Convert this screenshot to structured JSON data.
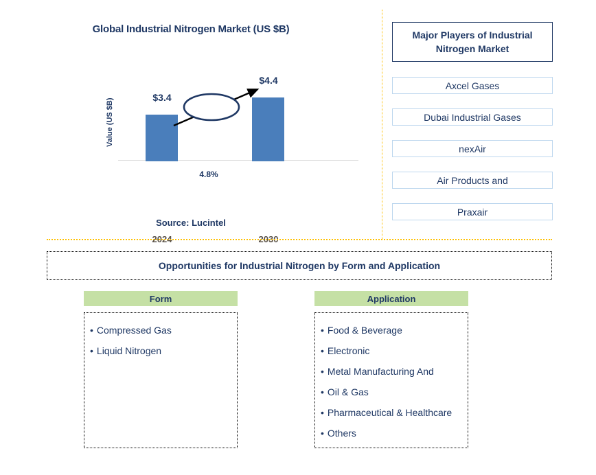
{
  "chart": {
    "title": "Global Industrial Nitrogen Market (US $B)",
    "y_axis_label": "Value (US $B)",
    "cagr_label": "4.8%",
    "source": "Source: Lucintel",
    "bar_color": "#4a7ebb",
    "label_color": "#1f3864"
  },
  "chart_data": {
    "type": "bar",
    "title": "Global Industrial Nitrogen Market (US $B)",
    "categories": [
      "2024",
      "2030"
    ],
    "values": [
      3.4,
      4.4
    ],
    "value_labels": [
      "$3.4",
      "$4.4"
    ],
    "xlabel": "",
    "ylabel": "Value (US $B)",
    "ylim": [
      0,
      5.2
    ],
    "grid": false,
    "legend": "none",
    "annotation": "4.8%",
    "annotation_meaning": "CAGR from 2024 to 2030",
    "source": "Source: Lucintel",
    "units": "US $B"
  },
  "players": {
    "header": "Major Players of Industrial Nitrogen Market",
    "items": [
      "Axcel Gases",
      "Dubai Industrial Gases",
      "nexAir",
      "Air Products and",
      "Praxair"
    ]
  },
  "opportunities": {
    "banner": "Opportunities for Industrial Nitrogen by Form and Application",
    "bullet": "•",
    "segments": [
      {
        "header": "Form",
        "items": [
          "Compressed Gas",
          "Liquid Nitrogen"
        ]
      },
      {
        "header": "Application",
        "items": [
          "Food & Beverage",
          "Electronic",
          "Metal Manufacturing And",
          "Oil & Gas",
          "Pharmaceutical & Healthcare",
          "Others"
        ]
      }
    ]
  }
}
